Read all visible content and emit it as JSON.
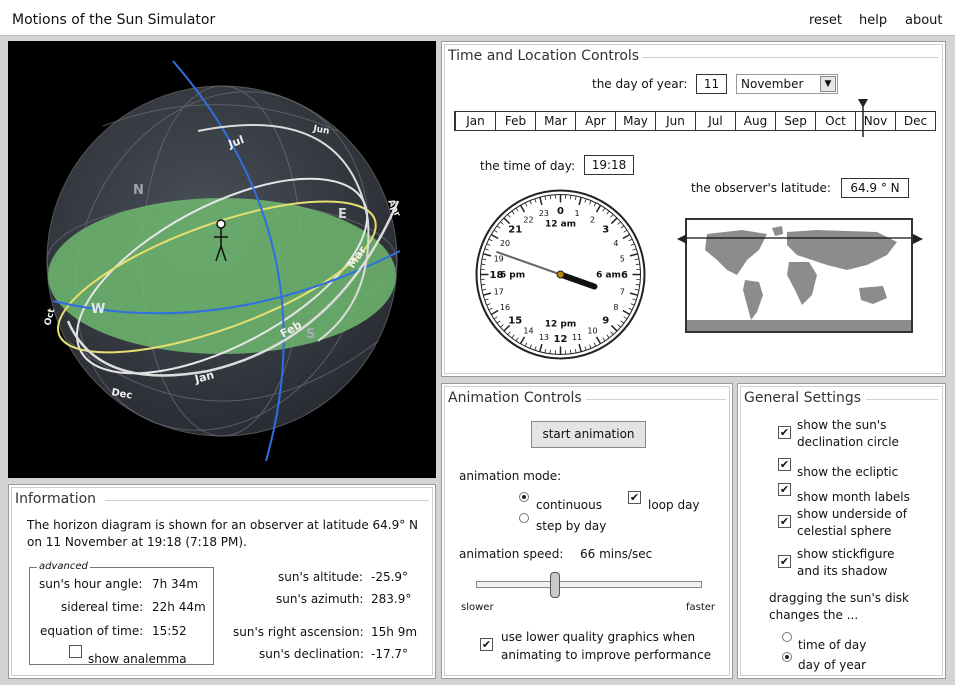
{
  "app": {
    "title": "Motions of the Sun Simulator",
    "nav": {
      "reset": "reset",
      "help": "help",
      "about": "about"
    }
  },
  "sphere": {
    "months": [
      "Jul",
      "Jun",
      "Apr",
      "Mar",
      "Feb",
      "Jan",
      "Dec",
      "Oct"
    ],
    "directions": {
      "N": "N",
      "E": "E",
      "W": "W",
      "S": "S"
    },
    "colors": {
      "background": "#000000",
      "horizon": "#6fbf73",
      "meridian": "#2f6fe0",
      "ecliptic": "#e8e07a"
    }
  },
  "time_location": {
    "title": "Time and Location Controls",
    "day_label": "the day of year:",
    "day_value": "11",
    "month_selected": "November",
    "month_dropdown_arrow": "▼",
    "month_strip": [
      "Jan",
      "Feb",
      "Mar",
      "Apr",
      "May",
      "Jun",
      "Jul",
      "Aug",
      "Sep",
      "Oct",
      "Nov",
      "Dec"
    ],
    "time_label": "the time of day:",
    "time_value": "19:18",
    "latitude_label": "the observer's latitude:",
    "latitude_value": "64.9 ° N",
    "clock": {
      "hours": [
        "0",
        "1",
        "2",
        "3",
        "4",
        "5",
        "6",
        "7",
        "8",
        "9",
        "10",
        "11",
        "12",
        "13",
        "14",
        "15",
        "16",
        "17",
        "18",
        "19",
        "20",
        "21",
        "22",
        "23"
      ],
      "bold_hours": [
        "0",
        "3",
        "6",
        "9",
        "12",
        "15",
        "18",
        "21"
      ],
      "labels": {
        "top": "12 am",
        "bottom": "12 pm",
        "right": "6 am",
        "left": "6 pm"
      }
    }
  },
  "animation": {
    "title": "Animation Controls",
    "start_button": "start animation",
    "mode_label": "animation mode:",
    "mode_continuous": "continuous",
    "mode_step": "step by day",
    "loop_day": "loop day",
    "speed_label": "animation speed:",
    "speed_value": "66 mins/sec",
    "slower": "slower",
    "faster": "faster",
    "low_quality_line1": "use lower quality graphics when",
    "low_quality_line2": "animating to improve performance",
    "checkmark": "✔",
    "speed_fraction": 0.35
  },
  "general": {
    "title": "General Settings",
    "opt_declination_1": "show the sun's",
    "opt_declination_2": "declination circle",
    "opt_ecliptic": "show the ecliptic",
    "opt_month_labels": "show month labels",
    "opt_underside_1": "show underside of",
    "opt_underside_2": "celestial sphere",
    "opt_stick_1": "show stickfigure",
    "opt_stick_2": "and its shadow",
    "drag_line1": "dragging the sun's disk",
    "drag_line2": "changes the ...",
    "drag_time": "time of day",
    "drag_day": "day of year"
  },
  "info": {
    "title": "Information",
    "line1": "The horizon diagram is shown for an observer at latitude 64.9° N",
    "line2": "on 11 November at 19:18 (7:18 PM).",
    "advanced": "advanced",
    "hour_angle_label": "sun's hour angle:",
    "hour_angle_value": "7h 34m",
    "sidereal_label": "sidereal time:",
    "sidereal_value": "22h 44m",
    "eqtime_label": "equation of time:",
    "eqtime_value": "15:52",
    "analemma": "show analemma",
    "altitude_label": "sun's altitude:",
    "altitude_value": "-25.9°",
    "azimuth_label": "sun's azimuth:",
    "azimuth_value": "283.9°",
    "ra_label": "sun's right ascension:",
    "ra_value": "15h 9m",
    "decl_label": "sun's declination:",
    "decl_value": "-17.7°"
  }
}
